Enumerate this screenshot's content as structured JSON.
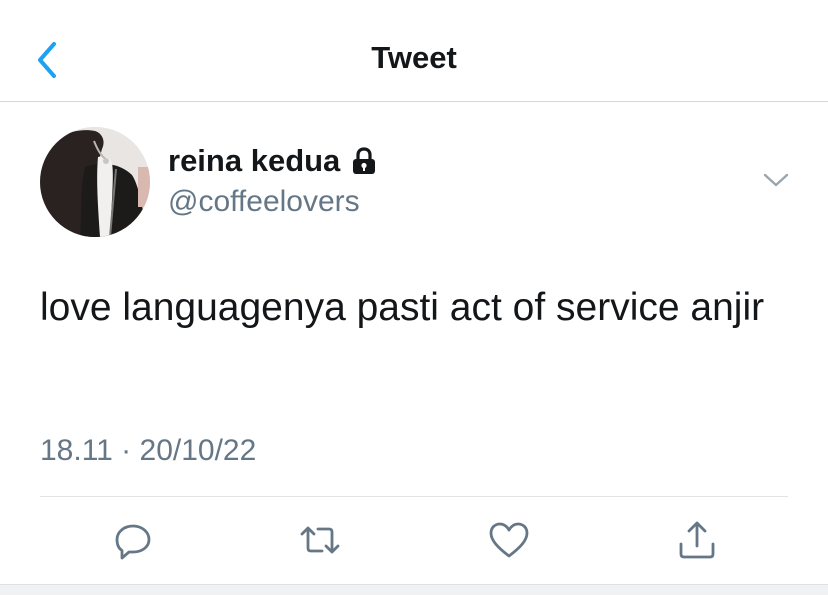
{
  "header": {
    "title": "Tweet",
    "back_icon": "chevron-left-icon"
  },
  "tweet": {
    "author": {
      "display_name": "reina kedua",
      "handle": "@coffeelovers",
      "protected_icon": "lock-icon"
    },
    "text": "love languagenya pasti act of service anjir",
    "timestamp": "18.11 · 20/10/22"
  },
  "actions": [
    {
      "name": "reply",
      "icon": "reply-icon"
    },
    {
      "name": "retweet",
      "icon": "retweet-icon"
    },
    {
      "name": "like",
      "icon": "heart-icon"
    },
    {
      "name": "share",
      "icon": "share-icon"
    }
  ],
  "colors": {
    "accent": "#1da1f2",
    "text_primary": "#14171a",
    "text_secondary": "#657786",
    "divider": "#e1e4e7"
  }
}
